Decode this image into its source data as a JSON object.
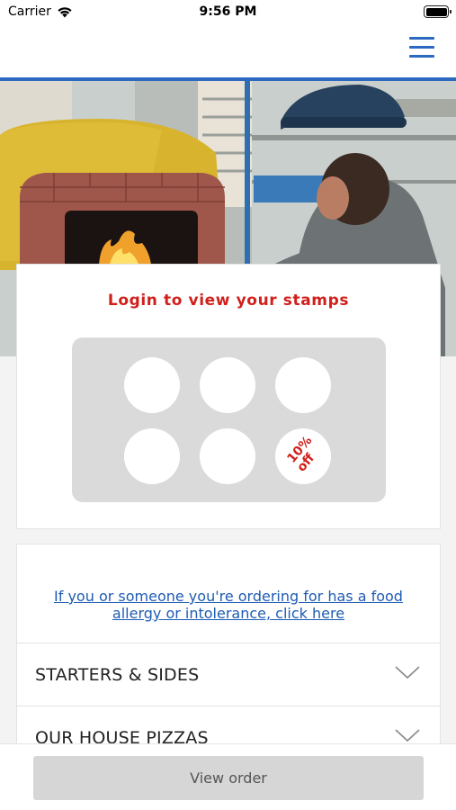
{
  "status_bar": {
    "carrier": "Carrier",
    "time": "9:56 PM"
  },
  "header": {
    "menu_icon": "hamburger-menu-icon",
    "accent_color": "#2c69c0"
  },
  "hero": {
    "image": "pizza chef beside a wood-fired brick oven"
  },
  "stamp_card": {
    "login_text": "Login to view your stamps",
    "stamps_total": 6,
    "reward_line1": "10%",
    "reward_line2": "off",
    "reward_color": "#d0201c"
  },
  "menu": {
    "allergy_text": "If you or someone you're ordering for has a food allergy or intolerance, click here",
    "categories": [
      {
        "label": "STARTERS & SIDES",
        "icon": "chevron-down-icon"
      },
      {
        "label": "OUR HOUSE PIZZAS",
        "icon": "chevron-down-icon"
      }
    ]
  },
  "footer": {
    "view_order_label": "View order"
  }
}
